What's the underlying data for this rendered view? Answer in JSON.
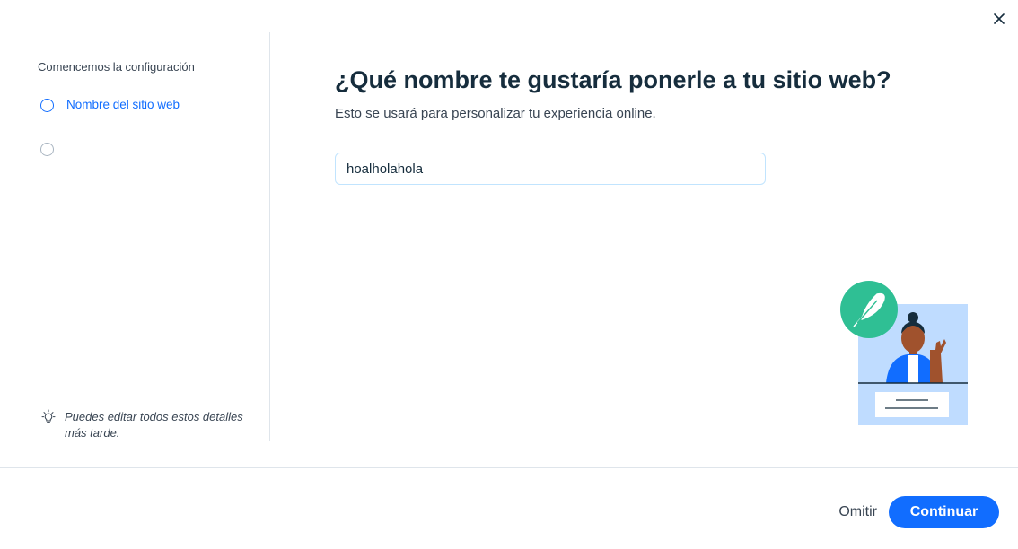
{
  "sidebar": {
    "title": "Comencemos la configuración",
    "steps": [
      {
        "label": "Nombre del sitio web",
        "state": "active"
      },
      {
        "label": "",
        "state": "pending"
      }
    ],
    "tip": "Puedes editar todos estos detalles más tarde."
  },
  "main": {
    "title": "¿Qué nombre te gustaría ponerle a tu sitio web?",
    "subtitle": "Esto se usará para personalizar tu experiencia online.",
    "site_name_input": {
      "value": "hoalholahola",
      "placeholder": ""
    }
  },
  "footer": {
    "skip_label": "Omitir",
    "continue_label": "Continuar"
  },
  "icons": {
    "close": "close-icon",
    "tip": "lightbulb-icon",
    "illustration_badge": "feather-icon"
  },
  "colors": {
    "accent": "#116dff",
    "text": "#162d3d",
    "illustration_teal": "#2fbf94",
    "illustration_bg": "#bfdcff"
  }
}
